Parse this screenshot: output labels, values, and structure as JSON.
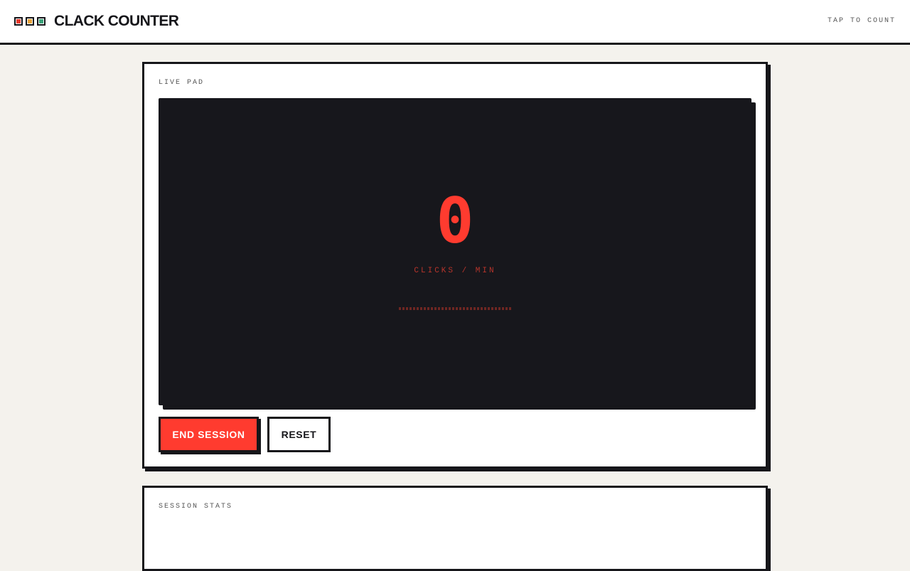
{
  "header": {
    "title": "CLACK COUNTER",
    "hint": "TAP TO COUNT",
    "logo_colors": [
      "#e8392c",
      "#e8a33a",
      "#3aa37a"
    ]
  },
  "live_pad": {
    "label": "LIVE PAD",
    "count": "0",
    "unit": "CLICKS / MIN",
    "meter_fill": 0
  },
  "actions": {
    "end_session": "END SESSION",
    "reset": "RESET"
  },
  "stats": {
    "label": "SESSION STATS"
  },
  "colors": {
    "accent": "#ff3b2f",
    "ink": "#16161a",
    "background": "#f4f2ed",
    "pad": "#17171c"
  }
}
